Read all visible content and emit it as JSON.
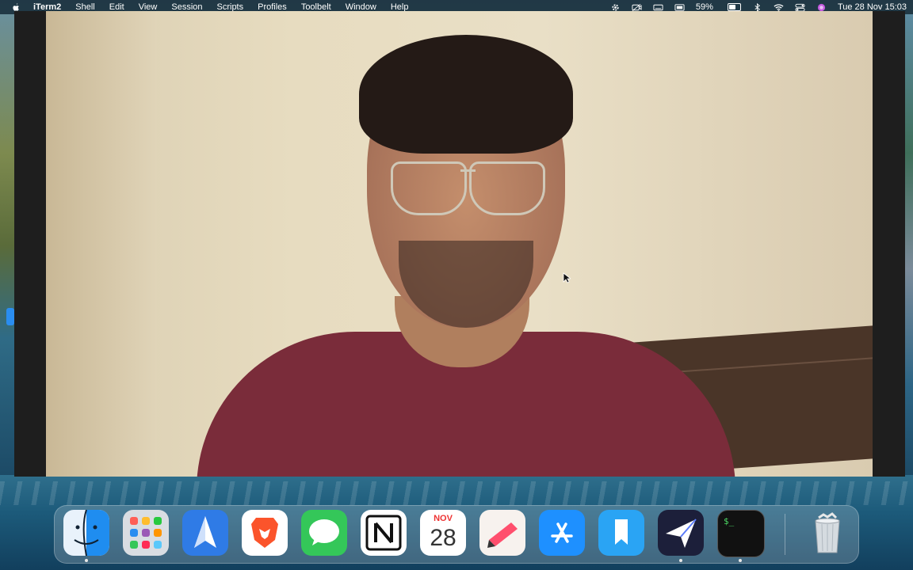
{
  "menubar": {
    "app_name": "iTerm2",
    "items": [
      "Shell",
      "Edit",
      "View",
      "Session",
      "Scripts",
      "Profiles",
      "Toolbelt",
      "Window",
      "Help"
    ],
    "battery_percent": "59%",
    "battery_level": 0.59,
    "datetime": "Tue 28 Nov  15:03"
  },
  "dock": {
    "calendar_month": "NOV",
    "calendar_day": "28",
    "terminal_prompt": "$_",
    "apps": [
      "finder",
      "launchpad",
      "spark",
      "brave",
      "messages",
      "notion",
      "calendar",
      "craft",
      "app-store",
      "bookmarks",
      "direct",
      "terminal",
      "trash"
    ]
  },
  "colors": {
    "menubar_bg": "#1e2d37",
    "shirt": "#7a2c3a",
    "wall": "#e7dcc0"
  }
}
